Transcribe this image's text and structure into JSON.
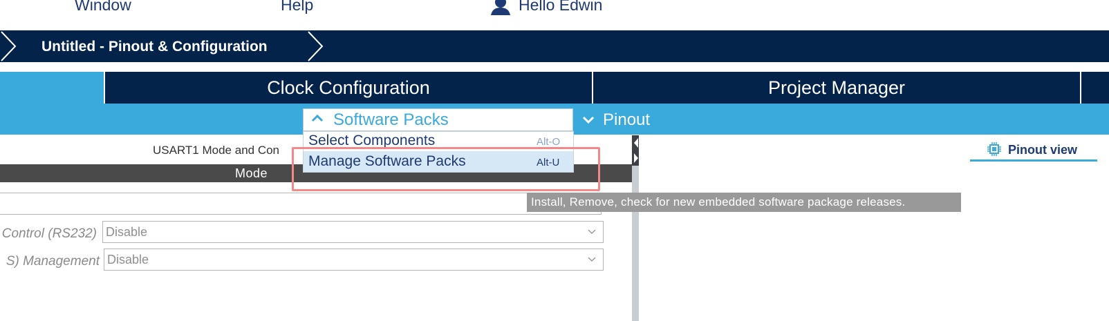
{
  "menubar": {
    "items": [
      {
        "label": "Window"
      },
      {
        "label": "Help"
      }
    ],
    "user_greeting": "Hello Edwin"
  },
  "breadcrumb": {
    "title": "Untitled - Pinout & Configuration"
  },
  "tabs": [
    {
      "label": "Clock Configuration"
    },
    {
      "label": "Project Manager"
    }
  ],
  "subtoolbar": {
    "software_packs_label": "Software Packs",
    "pinout_label": "Pinout"
  },
  "dropdown": {
    "items": [
      {
        "label": "Select Components",
        "shortcut": "Alt-O"
      },
      {
        "label": "Manage Software Packs",
        "shortcut": "Alt-U",
        "highlighted": true
      }
    ],
    "tooltip": "Install, Remove, check for new embedded software package releases."
  },
  "config_panel": {
    "section_title": "USART1 Mode and Con",
    "mode_header": "Mode",
    "fields": [
      {
        "label": "Control (RS232)",
        "value": "Disable"
      },
      {
        "label": "S) Management",
        "value": "Disable"
      }
    ]
  },
  "right_panel": {
    "pinout_view_label": "Pinout view"
  },
  "colors": {
    "navy": "#03234b",
    "accent_blue": "#3aa9dc",
    "highlight_box": "#f2888a",
    "tooltip_bg": "#999999"
  }
}
